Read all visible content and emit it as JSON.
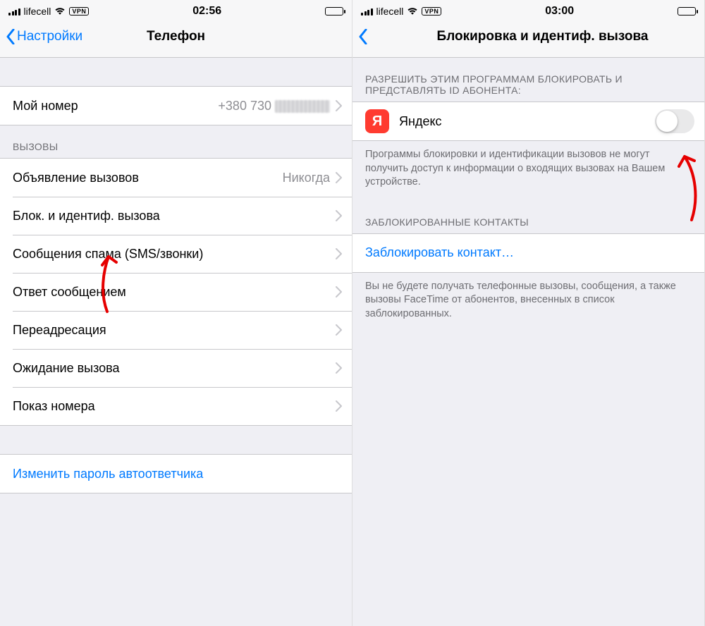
{
  "colors": {
    "accent": "#007aff",
    "yandex": "#ff3b30"
  },
  "left": {
    "status": {
      "carrier": "lifecell",
      "vpn": "VPN",
      "time": "02:56"
    },
    "nav": {
      "back": "Настройки",
      "title": "Телефон"
    },
    "my_number": {
      "label": "Мой номер",
      "value_prefix": "+380 730"
    },
    "section_calls_header": "ВЫЗОВЫ",
    "rows": {
      "announce": {
        "label": "Объявление вызовов",
        "value": "Никогда"
      },
      "block_id": {
        "label": "Блок. и идентиф. вызова"
      },
      "spam": {
        "label": "Сообщения спама (SMS/звонки)"
      },
      "respond": {
        "label": "Ответ сообщением"
      },
      "forward": {
        "label": "Переадресация"
      },
      "waiting": {
        "label": "Ожидание вызова"
      },
      "caller_id": {
        "label": "Показ номера"
      }
    },
    "change_vm_pw": "Изменить пароль автоответчика"
  },
  "right": {
    "status": {
      "carrier": "lifecell",
      "vpn": "VPN",
      "time": "03:00"
    },
    "nav": {
      "title": "Блокировка и идентиф. вызова"
    },
    "allow_header": "РАЗРЕШИТЬ ЭТИМ ПРОГРАММАМ БЛОКИРОВАТЬ И ПРЕДСТАВЛЯТЬ ID АБОНЕНТА:",
    "yandex": {
      "glyph": "Я",
      "label": "Яндекс",
      "enabled": false
    },
    "allow_footer": "Программы блокировки и идентификации вызовов не могут получить доступ к информации о входящих вызовах на Вашем устройстве.",
    "blocked_header": "ЗАБЛОКИРОВАННЫЕ КОНТАКТЫ",
    "block_contact": "Заблокировать контакт…",
    "blocked_footer": "Вы не будете получать телефонные вызовы, сообщения, а также вызовы FaceTime от абонентов, внесенных в список заблокированных."
  }
}
